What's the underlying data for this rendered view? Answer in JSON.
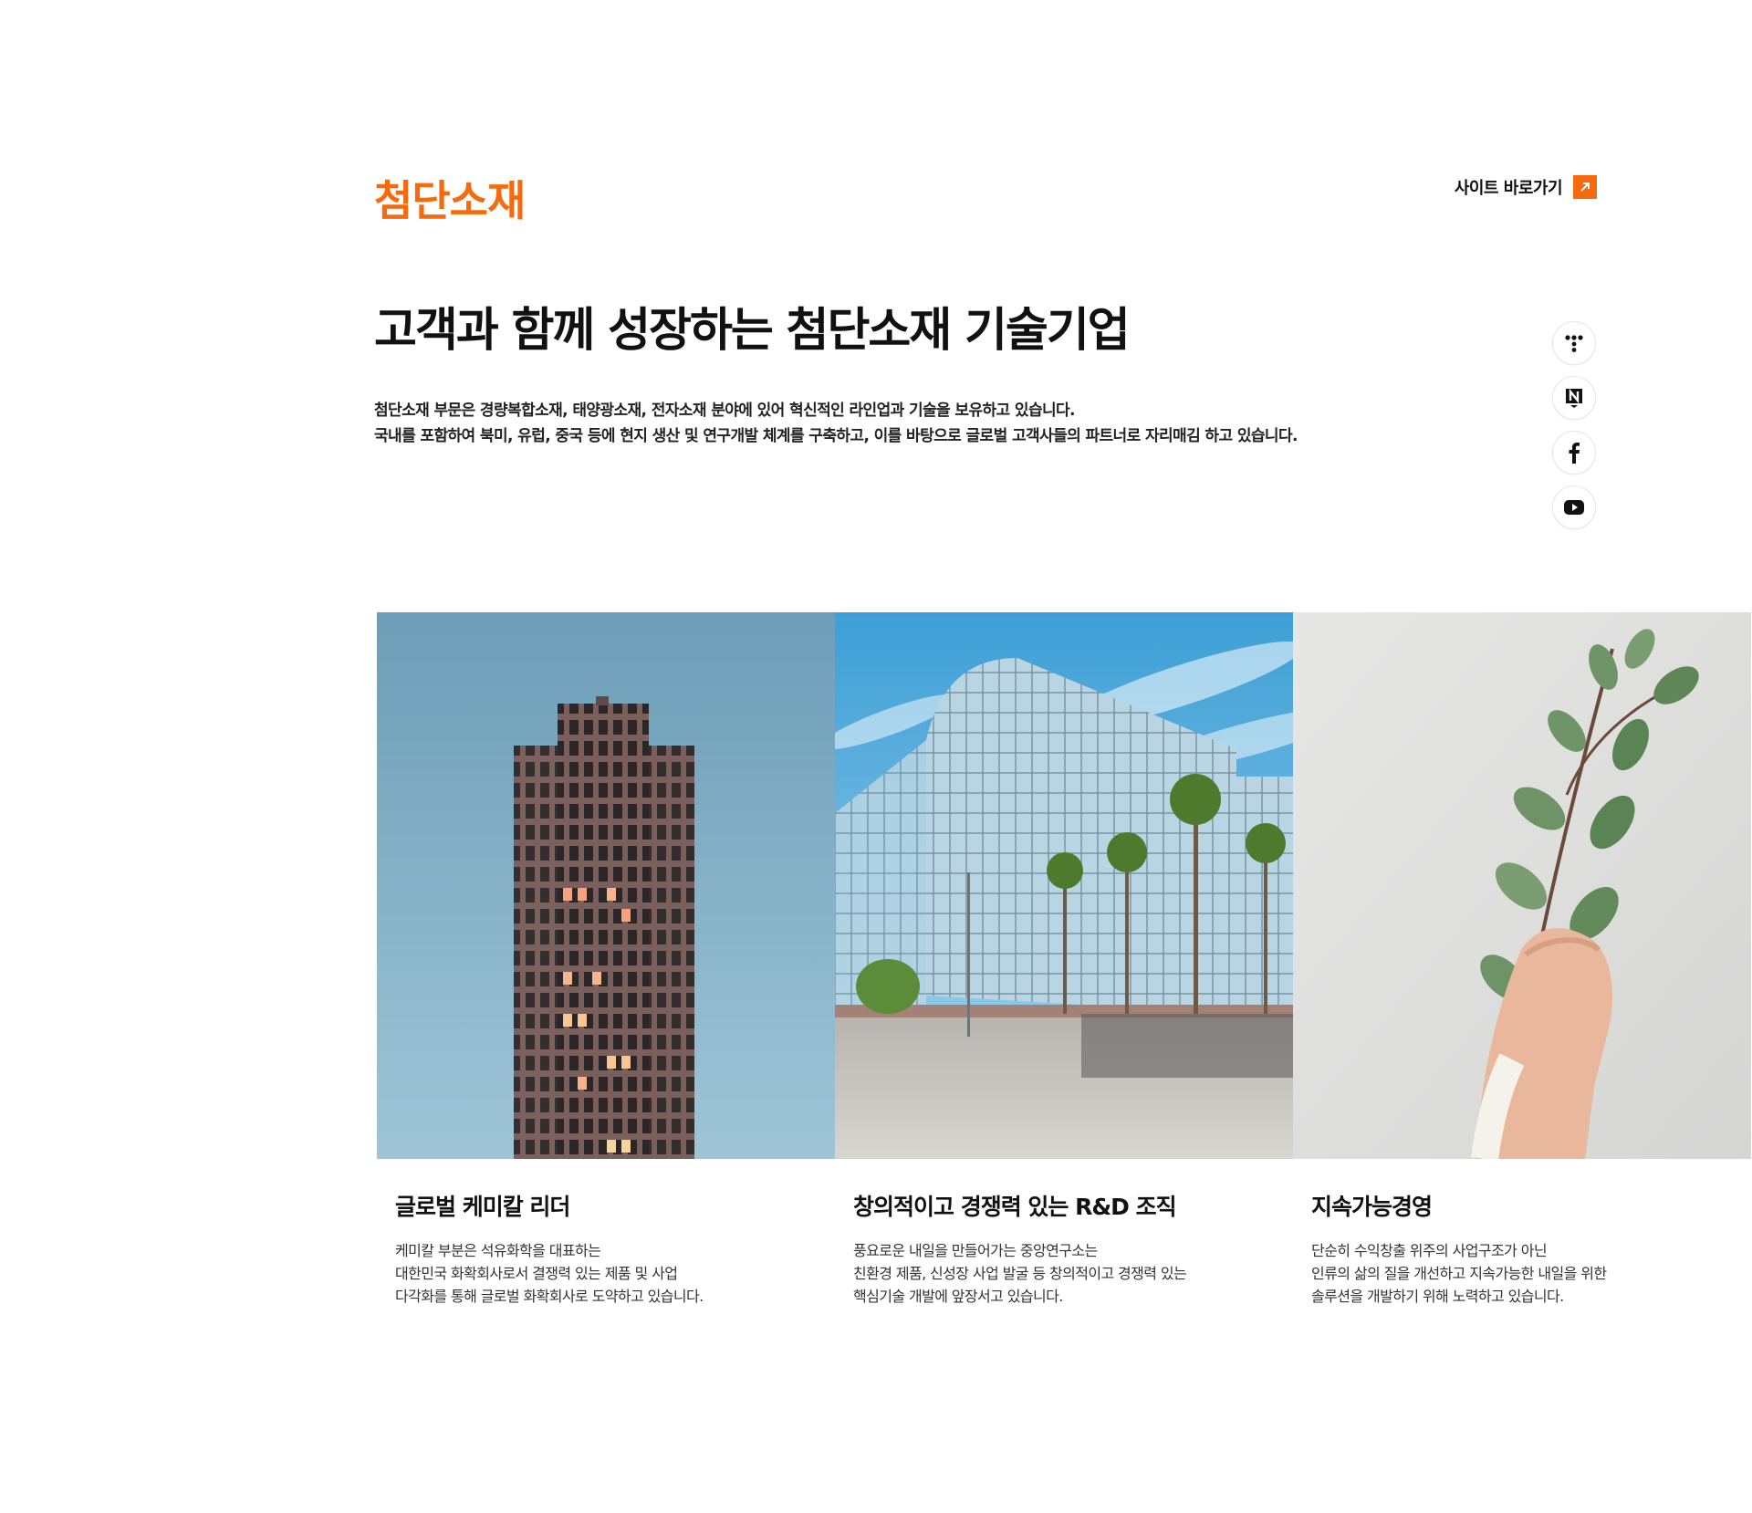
{
  "header": {
    "section_label": "첨단소재",
    "site_link_label": "사이트 바로가기"
  },
  "hero": {
    "headline": "고객과 함께 성장하는 첨단소재 기술기업",
    "description_lines": [
      "첨단소재 부문은 경량복합소재, 태양광소재, 전자소재 분야에 있어 혁신적인 라인업과 기술을 보유하고 있습니다.",
      "국내를 포함하여 북미, 유럽, 중국 등에 현지 생산 및 연구개발 체계를 구축하고, 이를 바탕으로 글로벌 고객사들의 파트너로 자리매김 하고 있습니다."
    ]
  },
  "social": {
    "icons": [
      "tmap-icon",
      "naver-post-icon",
      "facebook-icon",
      "youtube-icon"
    ]
  },
  "cards": [
    {
      "title": "글로벌 케미칼 리더",
      "lines": [
        "케미칼 부분은 석유화학을 대표하는",
        "대한민국 화확회사로서 결쟁력 있는 제품 및 사업",
        "다각화를 통해 글로벌 화확회사로 도약하고 있습니다."
      ],
      "image": "skyscraper-photo"
    },
    {
      "title": "창의적이고 경쟁력 있는 R&D 조직",
      "lines": [
        "풍요로운 내일을 만들어가는 중앙연구소는",
        "친환경 제품, 신성장 사업 발굴 등 창의적이고 경쟁력 있는",
        "핵심기술 개발에 앞장서고 있습니다."
      ],
      "image": "glass-building-photo"
    },
    {
      "title": "지속가능경영",
      "lines": [
        "단순히 수익창출 위주의 사업구조가 아닌",
        "인류의 삶의 질을 개선하고 지속가능한 내일을 위한",
        "솔루션을 개발하기 위해 노력하고 있습니다."
      ],
      "image": "eucalyptus-hand-photo"
    }
  ],
  "colors": {
    "accent": "#f56a0c",
    "text": "#111111"
  }
}
